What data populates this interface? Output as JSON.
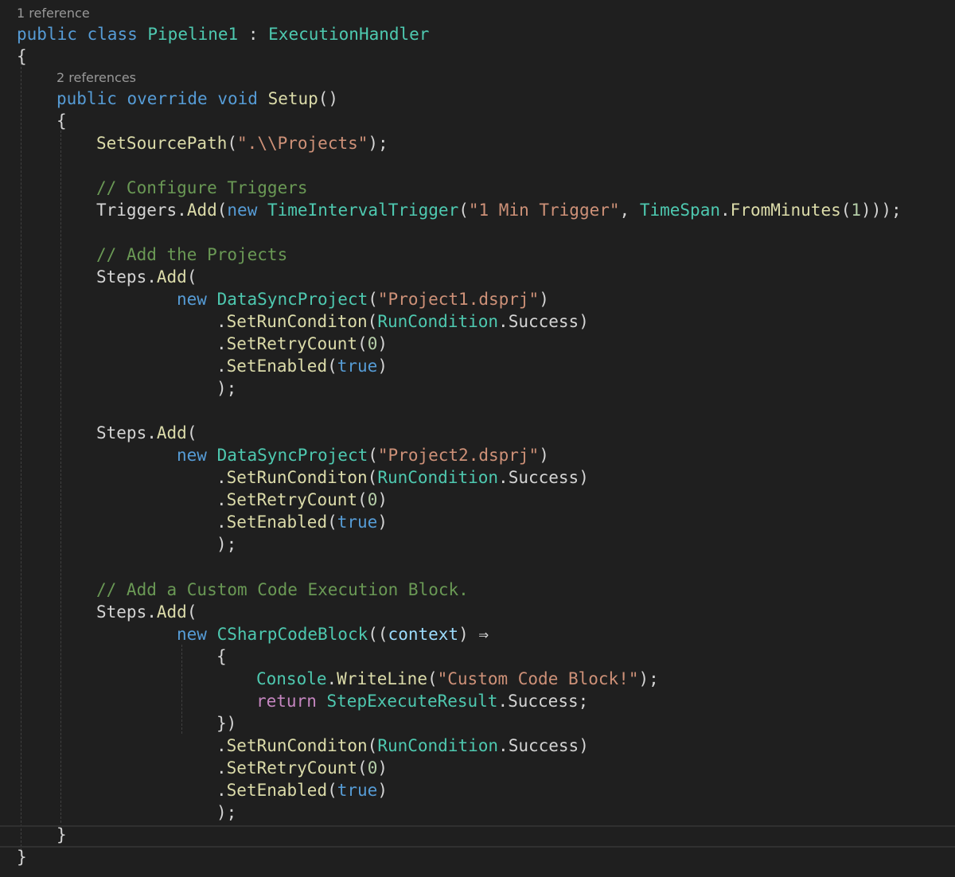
{
  "editor": {
    "codelens": {
      "class_refs": "1 reference",
      "method_refs": "2 references"
    },
    "tokens": {
      "kw_public": "public",
      "kw_class": "class",
      "class_name": "Pipeline1",
      "colon": ":",
      "base_type": "ExecutionHandler",
      "open_brace": "{",
      "close_brace": "}",
      "kw_override": "override",
      "kw_void": "void",
      "method_setup": "Setup",
      "parens": "()",
      "fn_setsourcepath": "SetSourcePath",
      "lparen": "(",
      "rparen": ")",
      "str_path": "\".\\\\Projects\"",
      "end_stmt": ");",
      "comment_triggers": "// Configure Triggers",
      "prop_triggers": "Triggers",
      "dot": ".",
      "fn_add": "Add",
      "kw_new": "new",
      "type_timeinterval": "TimeIntervalTrigger",
      "str_1min": "\"1 Min Trigger\"",
      "comma": ",",
      "type_timespan": "TimeSpan",
      "fn_fromminutes": "FromMinutes",
      "num_1": "1",
      "end_triple": ")));",
      "comment_projects": "// Add the Projects",
      "prop_steps": "Steps",
      "type_datasync": "DataSyncProject",
      "str_project1": "\"Project1.dsprj\"",
      "str_project2": "\"Project2.dsprj\"",
      "fn_setruncondition": "SetRunConditon",
      "type_runcondition": "RunCondition",
      "prop_success": "Success",
      "fn_setretry": "SetRetryCount",
      "num_0": "0",
      "fn_setenabled": "SetEnabled",
      "kw_true": "true",
      "comment_custom": "// Add a Custom Code Execution Block.",
      "type_csharpblock": "CSharpCodeBlock",
      "lparen2": "((",
      "param_context": "context",
      "arrow": "⇒",
      "type_console": "Console",
      "fn_writeline": "WriteLine",
      "str_custom": "\"Custom Code Block!\"",
      "kw_return": "return",
      "type_stepresult": "StepExecuteResult",
      "semicolon": ";",
      "close_lambda": "})"
    },
    "colors": {
      "background": "#1f1f1f",
      "keyword": "#569cd6",
      "control": "#c586c0",
      "type": "#4ec9b0",
      "function": "#dcdcaa",
      "string": "#ce9178",
      "comment": "#6a9955",
      "number": "#b5cea8",
      "parameter": "#9cdcfe",
      "text": "#d4d4d4",
      "codelens": "#999999"
    }
  }
}
